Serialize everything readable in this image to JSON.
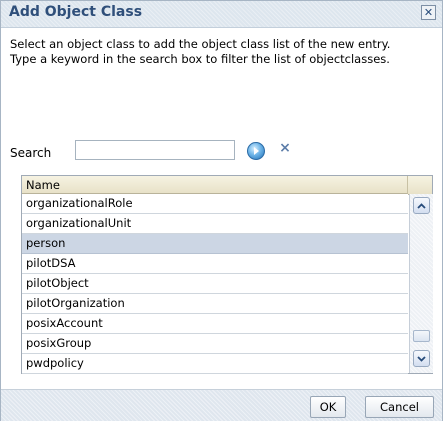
{
  "dialog": {
    "title": "Add Object Class",
    "close_symbol": "✕",
    "description": [
      "Select an object class to add the object class list of the new entry.",
      "Type a keyword in the search box to filter the list of objectclasses."
    ]
  },
  "search": {
    "label": "Search",
    "value": "",
    "placeholder": "",
    "go_icon": "go-arrow-icon",
    "clear_icon": "clear-icon",
    "clear_symbol": "⨯"
  },
  "table": {
    "column_header": "Name",
    "rows": [
      "organizationalRole",
      "organizationalUnit",
      "person",
      "pilotDSA",
      "pilotObject",
      "pilotOrganization",
      "posixAccount",
      "posixGroup",
      "pwdpolicy"
    ],
    "selected_row": "person"
  },
  "footer": {
    "ok_label": "OK",
    "cancel_label": "Cancel"
  },
  "colors": {
    "title_text": "#2f4f7a",
    "selection": "#ccd6e4",
    "header_bg": "#e8e2c8"
  }
}
